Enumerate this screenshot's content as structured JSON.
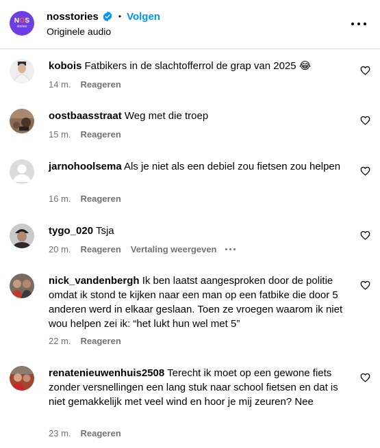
{
  "header": {
    "avatar_text": "NOS",
    "avatar_sub": "stories",
    "username": "nosstories",
    "separator": "•",
    "follow_label": "Volgen",
    "subtitle": "Originele audio"
  },
  "comments": [
    {
      "username": "kobois",
      "text": "Fatbikers in de slachtofferrol de grap van 2025 😂",
      "time": "14 m.",
      "reply": "Reageren"
    },
    {
      "username": "oostbaasstraat",
      "text": "Weg met die troep",
      "time": "15 m.",
      "reply": "Reageren"
    },
    {
      "username": "jarnohoolsema",
      "text": "Als je niet als een debiel zou fietsen zou helpen",
      "time": "16 m.",
      "reply": "Reageren"
    },
    {
      "username": "tygo_020",
      "text": "Tsja",
      "time": "20 m.",
      "reply": "Reageren",
      "translate": "Vertaling weergeven"
    },
    {
      "username": "nick_vandenbergh",
      "text": "Ik ben laatst aangesproken door de politie omdat ik stond te kijken naar een man op een fatbike die door 5 anderen werd in elkaar geslaan. Toen ze vroegen waarom ik niet wou helpen zei ik: “het lukt hun wel met 5”",
      "time": "22 m.",
      "reply": "Reageren"
    },
    {
      "username": "renatenieuwenhuis2508",
      "text": "Terecht ik moet op een gewone fiets zonder versnellingen een lang stuk naar school fietsen en dat is niet gemakkelijk met veel wind en hoor je mij zeuren? Nee",
      "time": "23 m.",
      "reply": "Reageren"
    }
  ],
  "colors": {
    "link": "#0095f6",
    "meta": "#737373",
    "avatar_brand": "#6d3ee6"
  }
}
